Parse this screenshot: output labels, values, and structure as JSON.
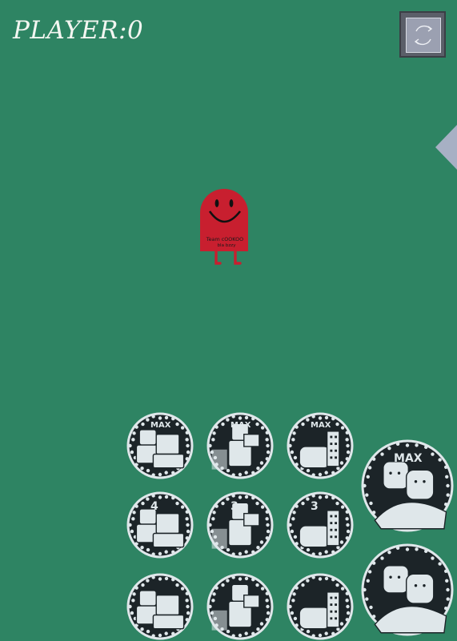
{
  "hud": {
    "score_text": "PLAYER:0"
  },
  "mascot": {
    "label_line1": "Team cOOKOO",
    "label_line2": "bla bzzy"
  },
  "grid": {
    "coins": [
      {
        "id": "c1",
        "variant": "figure-desk",
        "caption": "MAX"
      },
      {
        "id": "c2",
        "variant": "figure-card",
        "caption": "MAX"
      },
      {
        "id": "c3",
        "variant": "block",
        "caption": "MAX"
      },
      {
        "id": "c4",
        "variant": "figure-desk",
        "caption": "4"
      },
      {
        "id": "c5",
        "variant": "figure-card",
        "caption": "3"
      },
      {
        "id": "c6",
        "variant": "block",
        "caption": "3"
      },
      {
        "id": "c7",
        "variant": "figure-desk",
        "caption": ""
      },
      {
        "id": "c8",
        "variant": "figure-card",
        "caption": ""
      },
      {
        "id": "c9",
        "variant": "block",
        "caption": ""
      }
    ],
    "merged": [
      {
        "id": "m1",
        "variant": "duo",
        "caption": "MAX"
      },
      {
        "id": "m2",
        "variant": "duo",
        "caption": ""
      }
    ]
  },
  "colors": {
    "background": "#2e8463",
    "mascot_red": "#c81f2f",
    "coin_dark": "#1c2428",
    "coin_light": "#dfe7ea"
  }
}
